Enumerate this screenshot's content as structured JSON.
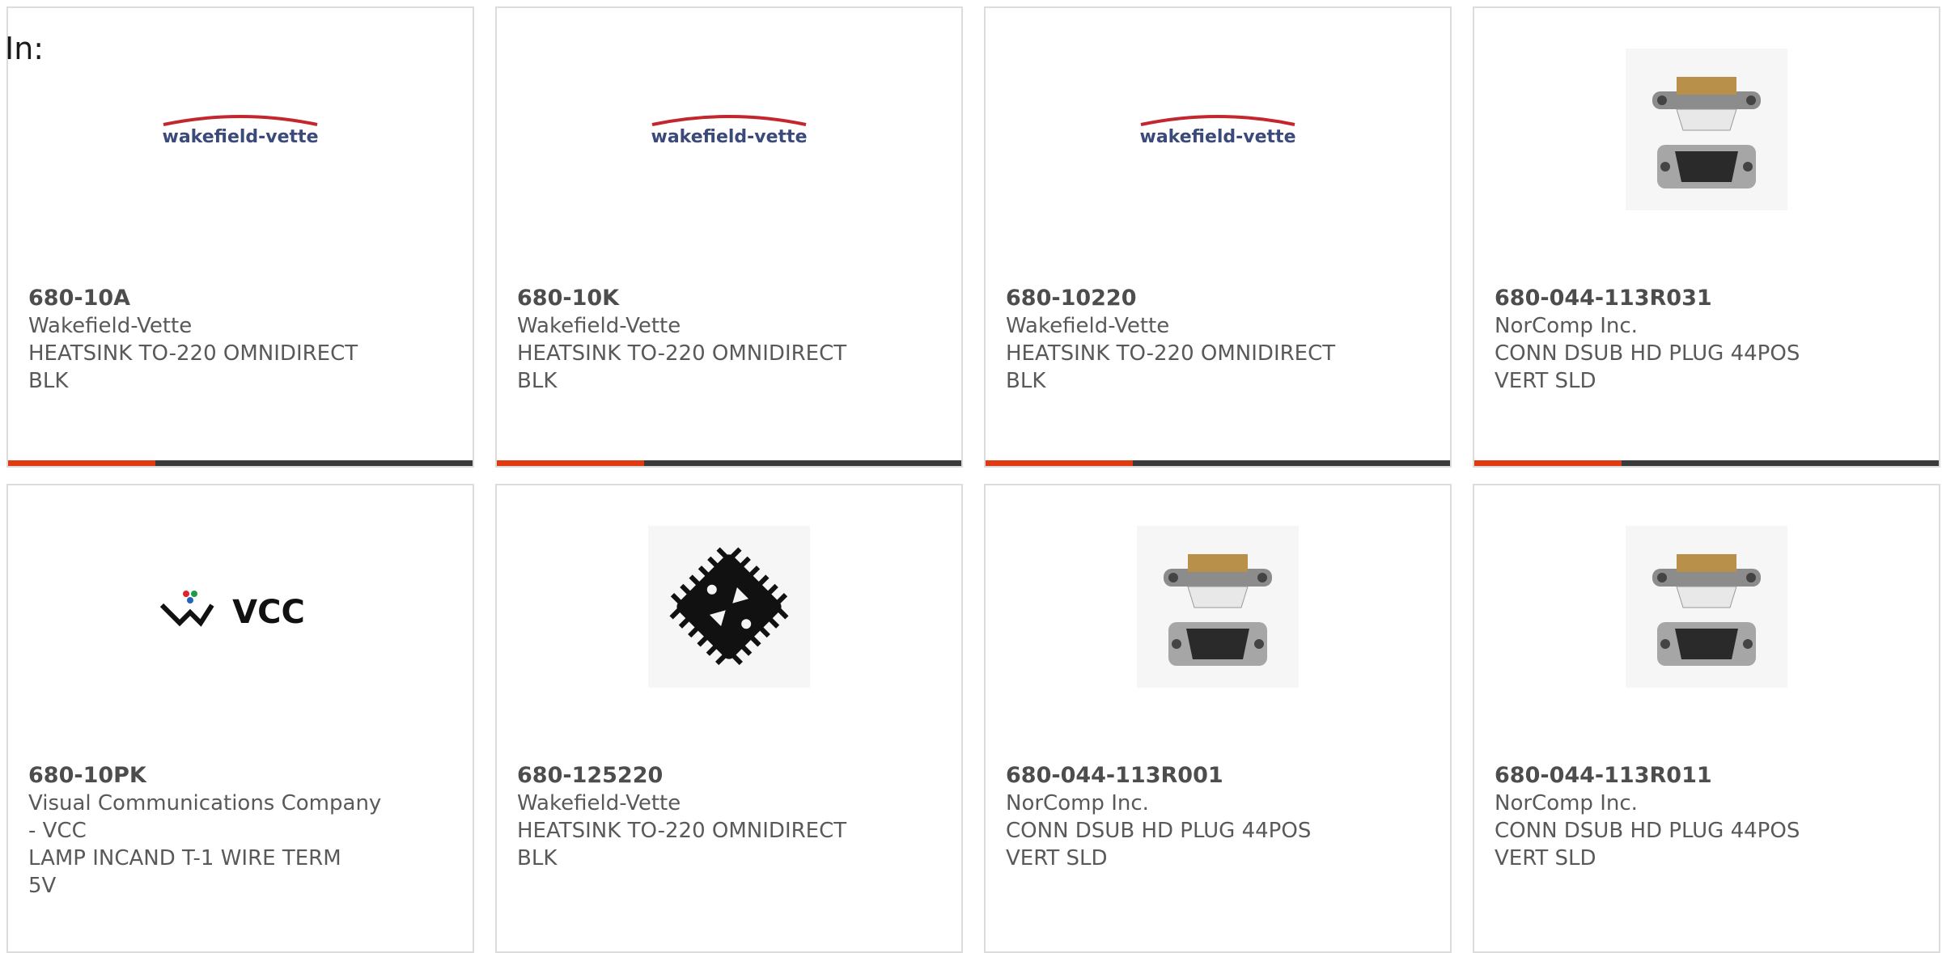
{
  "page": {
    "label": "In:"
  },
  "colors": {
    "accent": "#e03a12",
    "bar": "#3a3a3a",
    "border": "#dcdcdc"
  },
  "cards": [
    {
      "part": "680-10A",
      "maker": "Wakefield-Vette",
      "desc1": "HEATSINK TO-220 OMNIDIRECT",
      "desc2": "BLK",
      "desc3": "",
      "image": "wakefield-vette-logo",
      "logo_text": "wakefield-vette"
    },
    {
      "part": "680-10K",
      "maker": "Wakefield-Vette",
      "desc1": "HEATSINK TO-220 OMNIDIRECT",
      "desc2": "BLK",
      "desc3": "",
      "image": "wakefield-vette-logo",
      "logo_text": "wakefield-vette"
    },
    {
      "part": "680-10220",
      "maker": "Wakefield-Vette",
      "desc1": "HEATSINK TO-220 OMNIDIRECT",
      "desc2": "BLK",
      "desc3": "",
      "image": "wakefield-vette-logo",
      "logo_text": "wakefield-vette"
    },
    {
      "part": "680-044-113R031",
      "maker": "NorComp Inc.",
      "desc1": "CONN DSUB HD PLUG 44POS",
      "desc2": "VERT SLD",
      "desc3": "",
      "image": "dsub-connector-photo"
    },
    {
      "part": "680-10PK",
      "maker": "Visual Communications Company",
      "desc1": "- VCC",
      "desc2": "LAMP INCAND T-1 WIRE TERM",
      "desc3": "5V",
      "image": "vcc-logo",
      "logo_text": "VCC"
    },
    {
      "part": "680-125220",
      "maker": "Wakefield-Vette",
      "desc1": "HEATSINK TO-220 OMNIDIRECT",
      "desc2": "BLK",
      "desc3": "",
      "image": "heatsink-photo"
    },
    {
      "part": "680-044-113R001",
      "maker": "NorComp Inc.",
      "desc1": "CONN DSUB HD PLUG 44POS",
      "desc2": "VERT SLD",
      "desc3": "",
      "image": "dsub-connector-photo"
    },
    {
      "part": "680-044-113R011",
      "maker": "NorComp Inc.",
      "desc1": "CONN DSUB HD PLUG 44POS",
      "desc2": "VERT SLD",
      "desc3": "",
      "image": "dsub-connector-photo"
    }
  ]
}
